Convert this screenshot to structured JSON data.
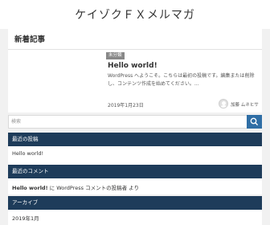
{
  "site": {
    "title": "ケイゾクＦＸメルマガ"
  },
  "new_posts": {
    "heading": "新着記事",
    "post": {
      "category": "未分類",
      "title": "Hello world!",
      "excerpt": "WordPress へようこそ。こちらは最初の投稿です。編集または削除し、コンテンツ作成を始めてください。...",
      "date": "2019年1月23日",
      "author": "加藤 ムネヒサ",
      "avatar_icon": "user-avatar-icon"
    }
  },
  "search": {
    "placeholder": "検索",
    "icon": "search-icon",
    "button_color": "#2f6ea5"
  },
  "widgets": {
    "recent_posts": {
      "heading": "最近の投稿",
      "item": "Hello world!"
    },
    "recent_comments": {
      "heading": "最近のコメント",
      "post_link": "Hello world!",
      "text_on": " に ",
      "commenter": "WordPress コメントの投稿者",
      "text_by": " より"
    },
    "archives": {
      "heading": "アーカイブ",
      "item": "2019年1月"
    }
  },
  "colors": {
    "widget_header": "#1e3c5a",
    "background": "#f1f1f1"
  }
}
